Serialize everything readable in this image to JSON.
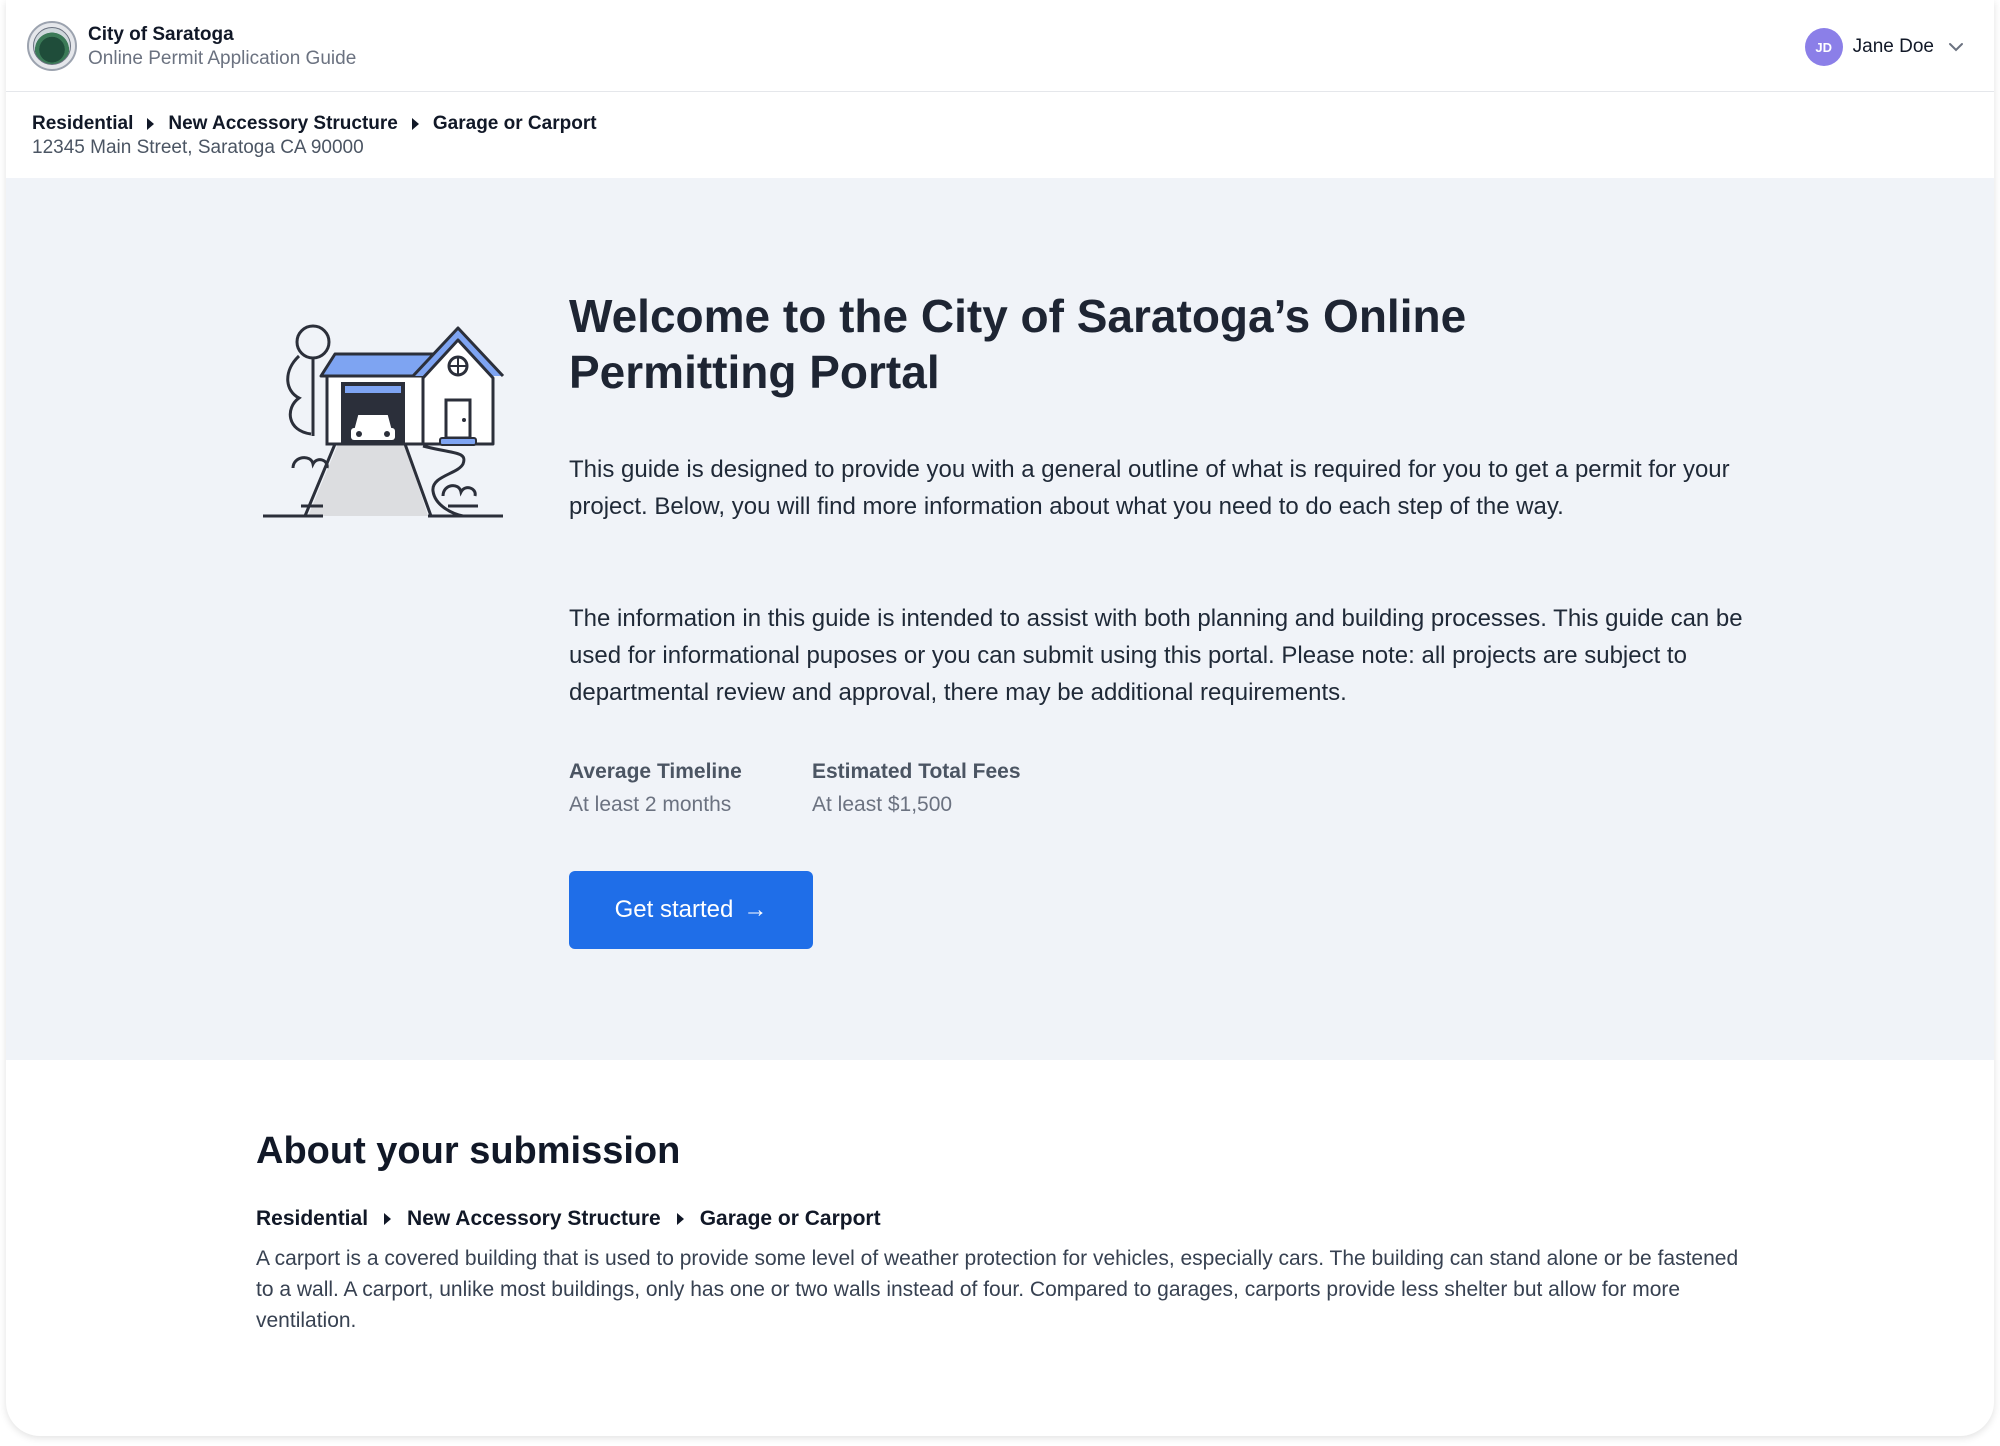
{
  "header": {
    "org_name": "City of Saratoga",
    "org_subtitle": "Online Permit Application Guide",
    "user": {
      "initials": "JD",
      "name": "Jane Doe",
      "avatar_color": "#8b7fe8"
    }
  },
  "breadcrumb": {
    "items": [
      "Residential",
      "New Accessory Structure",
      "Garage or Carport"
    ],
    "address": "12345 Main Street, Saratoga CA 90000"
  },
  "hero": {
    "title": "Welcome to the City of Saratoga’s Online Permitting Portal",
    "paragraph1": "This guide is designed to provide you with a general outline of what is required for you to get a permit for your project. Below, you will find more information about what you need to do each step of the way.",
    "paragraph2": "The information in this guide is intended to assist with both planning and building processes. This guide can be used for informational puposes or you can submit using this portal. Please note: all projects are subject to departmental review and approval, there may be additional requirements.",
    "stats": [
      {
        "label": "Average Timeline",
        "value": "At least 2 months"
      },
      {
        "label": "Estimated Total Fees",
        "value": "At least $1,500"
      }
    ],
    "cta_label": "Get started",
    "cta_arrow": "→",
    "accent_color": "#1f6ee8"
  },
  "about": {
    "title": "About your submission",
    "breadcrumb": [
      "Residential",
      "New Accessory Structure",
      "Garage or Carport"
    ],
    "description": "A carport is a covered building that is used to provide some level of weather protection for vehicles, especially cars. The building can stand alone or be fastened to a wall. A carport, unlike most buildings, only has one or two walls instead of four. Compared to garages, carports provide less shelter but allow for more ventilation."
  }
}
